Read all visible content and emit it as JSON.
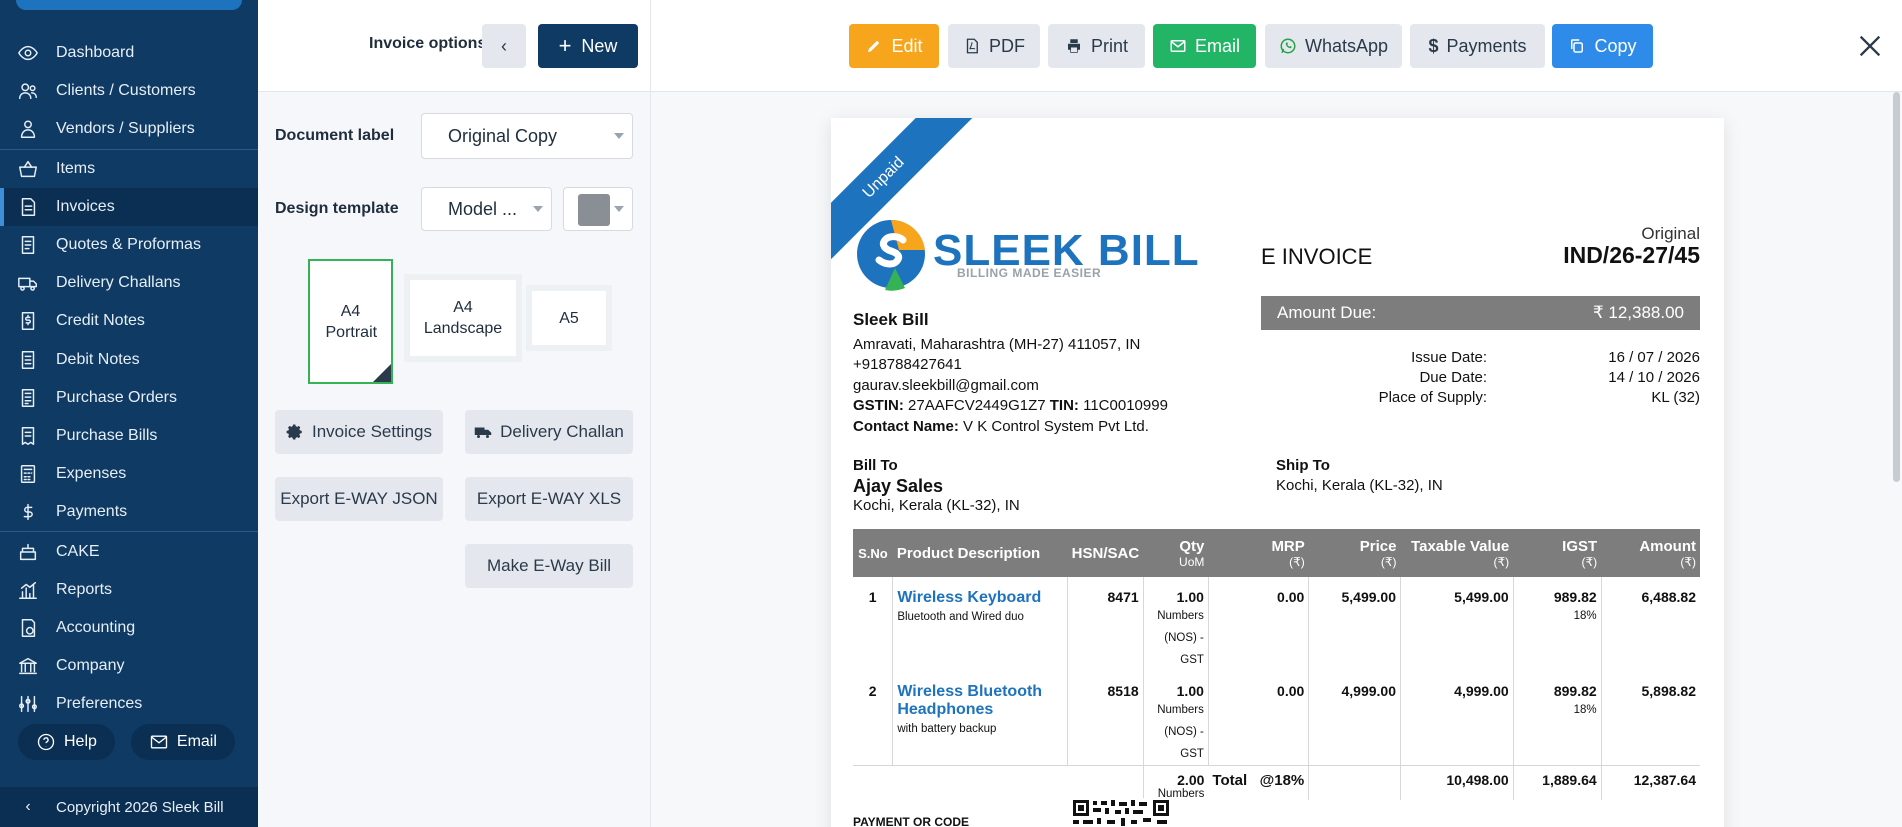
{
  "sidebar": {
    "items": [
      {
        "label": "Dashboard",
        "icon": "eye-icon"
      },
      {
        "label": "Clients / Customers",
        "icon": "users-icon"
      },
      {
        "label": "Vendors / Suppliers",
        "icon": "vendor-icon"
      },
      {
        "label": "Items",
        "icon": "basket-icon"
      },
      {
        "label": "Invoices",
        "icon": "invoice-icon"
      },
      {
        "label": "Quotes & Proformas",
        "icon": "document-icon"
      },
      {
        "label": "Delivery Challans",
        "icon": "truck-icon"
      },
      {
        "label": "Credit Notes",
        "icon": "dollar-doc-icon"
      },
      {
        "label": "Debit Notes",
        "icon": "debit-note-icon"
      },
      {
        "label": "Purchase Orders",
        "icon": "purchase-order-icon"
      },
      {
        "label": "Purchase Bills",
        "icon": "purchase-bill-icon"
      },
      {
        "label": "Expenses",
        "icon": "calculator-icon"
      },
      {
        "label": "Payments",
        "icon": "dollar-icon"
      },
      {
        "label": "CAKE",
        "icon": "cake-icon"
      },
      {
        "label": "Reports",
        "icon": "chart-icon"
      },
      {
        "label": "Accounting",
        "icon": "accounting-icon"
      },
      {
        "label": "Company",
        "icon": "bank-icon"
      },
      {
        "label": "Preferences",
        "icon": "sliders-icon"
      }
    ],
    "active": "Invoices",
    "help_label": "Help",
    "email_label": "Email",
    "copyright": "Copyright 2026 Sleek Bill"
  },
  "options": {
    "title": "Invoice options",
    "new_label": "New",
    "doc_label_title": "Document label",
    "doc_label_value": "Original Copy",
    "design_title": "Design template",
    "design_value": "Model ...",
    "swatch_color": "#8a8f95",
    "paper_a4p": "A4 Portrait",
    "paper_a4l": "A4 Landscape",
    "paper_a5": "A5",
    "invoice_settings": "Invoice Settings",
    "delivery_challan": "Delivery Challan",
    "export_json": "Export E-WAY JSON",
    "export_xls": "Export E-WAY XLS",
    "make_eway": "Make E-Way Bill"
  },
  "toolbar": {
    "edit": "Edit",
    "pdf": "PDF",
    "print": "Print",
    "email": "Email",
    "whatsapp": "WhatsApp",
    "payments": "Payments",
    "copy": "Copy"
  },
  "invoice": {
    "ribbon": "Unpaid",
    "brand": "SLEEK BILL",
    "tagline": "BILLING MADE EASIER",
    "title": "E INVOICE",
    "copy_label": "Original",
    "number": "IND/26-27/45",
    "amount_due_label": "Amount Due:",
    "amount_due": "₹ 12,388.00",
    "issue_date_label": "Issue Date:",
    "issue_date": "16 / 07 / 2026",
    "due_date_label": "Due Date:",
    "due_date": "14 / 10 / 2026",
    "place_label": "Place of Supply:",
    "place": "KL (32)",
    "seller_name": "Sleek Bill",
    "seller_addr": "Amravati, Maharashtra (MH-27) 411057, IN",
    "seller_phone": "+918788427641",
    "seller_email": "gaurav.sleekbill@gmail.com",
    "gstin_label": "GSTIN:",
    "gstin": "27AAFCV2449G1Z7",
    "tin_label": "TIN:",
    "tin": "11C0010999",
    "contact_label": "Contact Name:",
    "contact": "V K Control System Pvt Ltd.",
    "bill_to_label": "Bill To",
    "bill_to_name": "Ajay Sales",
    "bill_to_addr": "Kochi, Kerala (KL-32), IN",
    "ship_to_label": "Ship To",
    "ship_to_addr": "Kochi, Kerala (KL-32), IN",
    "columns": {
      "sno": "S.No",
      "product": "Product Description",
      "hsn": "HSN/SAC",
      "qty": "Qty",
      "qty_unit": "UoM",
      "mrp": "MRP",
      "price": "Price",
      "taxable": "Taxable Value",
      "igst": "IGST",
      "amount": "Amount",
      "rupee": "(₹)"
    },
    "rows": [
      {
        "sno": "1",
        "name": "Wireless Keyboard",
        "desc": "Bluetooth and Wired duo",
        "hsn": "8471",
        "qty": "1.00",
        "unit1": "Numbers",
        "unit2": "(NOS) -",
        "unit3": "GST",
        "mrp": "0.00",
        "price": "5,499.00",
        "taxable": "5,499.00",
        "igst": "989.82",
        "rate": "18%",
        "amount": "6,488.82"
      },
      {
        "sno": "2",
        "name": "Wireless Bluetooth Headphones",
        "desc": "with battery backup",
        "hsn": "8518",
        "qty": "1.00",
        "unit1": "Numbers",
        "unit2": "(NOS) -",
        "unit3": "GST",
        "mrp": "0.00",
        "price": "4,999.00",
        "taxable": "4,999.00",
        "igst": "899.82",
        "rate": "18%",
        "amount": "5,898.82"
      }
    ],
    "total_qty": "2.00",
    "total_unit": "Numbers",
    "total_label": "Total",
    "total_rate": "@18%",
    "total_taxable": "10,498.00",
    "total_igst": "1,889.64",
    "total_amount": "12,387.64",
    "payment_label": "PAYMENT OR CODE"
  }
}
